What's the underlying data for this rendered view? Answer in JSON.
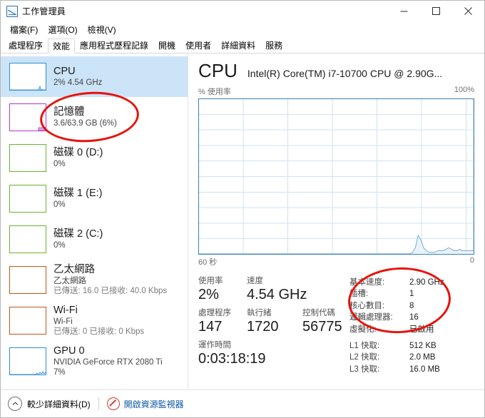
{
  "window": {
    "title": "工作管理員",
    "icon": "task-manager-icon",
    "minimize": "−",
    "maximize": "□",
    "close": "✕"
  },
  "menu": {
    "items": [
      {
        "label": "檔案(F)"
      },
      {
        "label": "選項(O)"
      },
      {
        "label": "檢視(V)"
      }
    ]
  },
  "tabs": {
    "active_index": 1,
    "items": [
      {
        "label": "處理程序"
      },
      {
        "label": "效能"
      },
      {
        "label": "應用程式歷程記錄"
      },
      {
        "label": "開機"
      },
      {
        "label": "使用者"
      },
      {
        "label": "詳細資料"
      },
      {
        "label": "服務"
      }
    ]
  },
  "sidebar": {
    "items": [
      {
        "name": "cpu",
        "title": "CPU",
        "sub1": "2%  4.54 GHz",
        "sub2": "",
        "color": "#2b8fd4",
        "selected": true
      },
      {
        "name": "memory",
        "title": "記憶體",
        "sub1": "3.6/63.9 GB (6%)",
        "sub2": "",
        "color": "#b337c6",
        "selected": false
      },
      {
        "name": "disk-0",
        "title": "磁碟 0 (D:)",
        "sub1": "0%",
        "sub2": "",
        "color": "#6bb52b",
        "selected": false
      },
      {
        "name": "disk-1",
        "title": "磁碟 1 (E:)",
        "sub1": "0%",
        "sub2": "",
        "color": "#6bb52b",
        "selected": false
      },
      {
        "name": "disk-2",
        "title": "磁碟 2 (C:)",
        "sub1": "0%",
        "sub2": "",
        "color": "#6bb52b",
        "selected": false
      },
      {
        "name": "ethernet",
        "title": "乙太網路",
        "sub1": "乙太網路",
        "sub2": "已傳送: 16.0 已接收: 40.0 Kbps",
        "color": "#c0571b",
        "selected": false
      },
      {
        "name": "wifi",
        "title": "Wi-Fi",
        "sub1": "Wi-Fi",
        "sub2": "已傳送: 0 已接收: 0 Kbps",
        "color": "#c0571b",
        "selected": false
      },
      {
        "name": "gpu-0",
        "title": "GPU 0",
        "sub1": "NVIDIA GeForce RTX 2080 Ti",
        "sub2": "7%",
        "color": "#2b8fd4",
        "selected": false
      }
    ]
  },
  "main": {
    "title": "CPU",
    "model": "Intel(R) Core(TM) i7-10700 CPU @ 2.90G...",
    "graph_label_left": "% 使用率",
    "graph_label_right": "100%",
    "time_left": "60 秒",
    "time_right": "0",
    "graph_line_color": "#2b7cb8",
    "graph_fill_color": "#eaf3fa",
    "stats": [
      {
        "label": "使用率",
        "value": "2%"
      },
      {
        "label": "速度",
        "value": "4.54 GHz"
      },
      {
        "label": "處理程序",
        "value": "147"
      },
      {
        "label": "執行緒",
        "value": "1720"
      },
      {
        "label": "控制代碼",
        "value": "56775"
      },
      {
        "label": "運作時間",
        "value": "0:03:18:19"
      }
    ],
    "specs": [
      {
        "key": "基本速度:",
        "value": "2.90 GHz"
      },
      {
        "key": "插槽:",
        "value": "1"
      },
      {
        "key": "核心數目:",
        "value": "8"
      },
      {
        "key": "邏輯處理器:",
        "value": "16"
      },
      {
        "key": "虛擬化:",
        "value": "已啟用"
      },
      {
        "key": "L1 快取:",
        "value": "512 KB"
      },
      {
        "key": "L2 快取:",
        "value": "2.0 MB"
      },
      {
        "key": "L3 快取:",
        "value": "16.0 MB"
      }
    ]
  },
  "annotations": {
    "color": "#e8120c",
    "shapes": [
      {
        "name": "annot-memory",
        "targets": "記憶體 3.6/63.9 GB (6%)"
      },
      {
        "name": "annot-specs",
        "targets": "基本速度/插槽/核心數目/邏輯處理器"
      }
    ]
  },
  "footer": {
    "less_details": "較少詳細資料(D)",
    "resource_monitor": "開啟資源監視器"
  },
  "chart_data": {
    "type": "area",
    "title": "% 使用率",
    "xlabel": "",
    "ylabel": "% 使用率",
    "ylim": [
      0,
      100
    ],
    "xlim": [
      60,
      0
    ],
    "x_tick_labels": [
      "60 秒",
      "0"
    ],
    "y_tick_labels": [
      "100%"
    ],
    "grid": true,
    "grid_columns": 6,
    "grid_rows": 10,
    "series": [
      {
        "name": "CPU 使用率",
        "color": "#2b7cb8",
        "values": [
          0,
          0,
          0,
          0,
          0,
          0,
          0,
          0,
          0,
          0,
          0,
          0,
          0,
          0,
          0,
          0,
          0,
          0,
          0,
          0,
          0,
          0,
          0,
          0,
          0,
          0,
          0,
          0,
          0,
          0,
          0,
          0,
          0,
          0,
          0,
          0,
          0,
          0,
          0,
          0,
          0,
          0,
          0,
          0,
          0,
          0,
          0,
          0,
          0,
          0,
          0,
          0,
          0,
          0,
          0,
          0,
          0,
          0,
          0,
          0,
          0,
          0,
          0,
          0,
          0,
          0,
          0,
          0,
          0,
          0,
          0,
          0,
          0,
          0,
          0,
          0,
          0,
          1,
          4,
          12,
          9,
          4,
          2,
          1,
          1,
          1,
          2,
          2,
          2,
          3,
          4,
          3,
          2,
          2,
          3,
          2,
          2,
          2,
          2,
          2
        ]
      }
    ]
  }
}
